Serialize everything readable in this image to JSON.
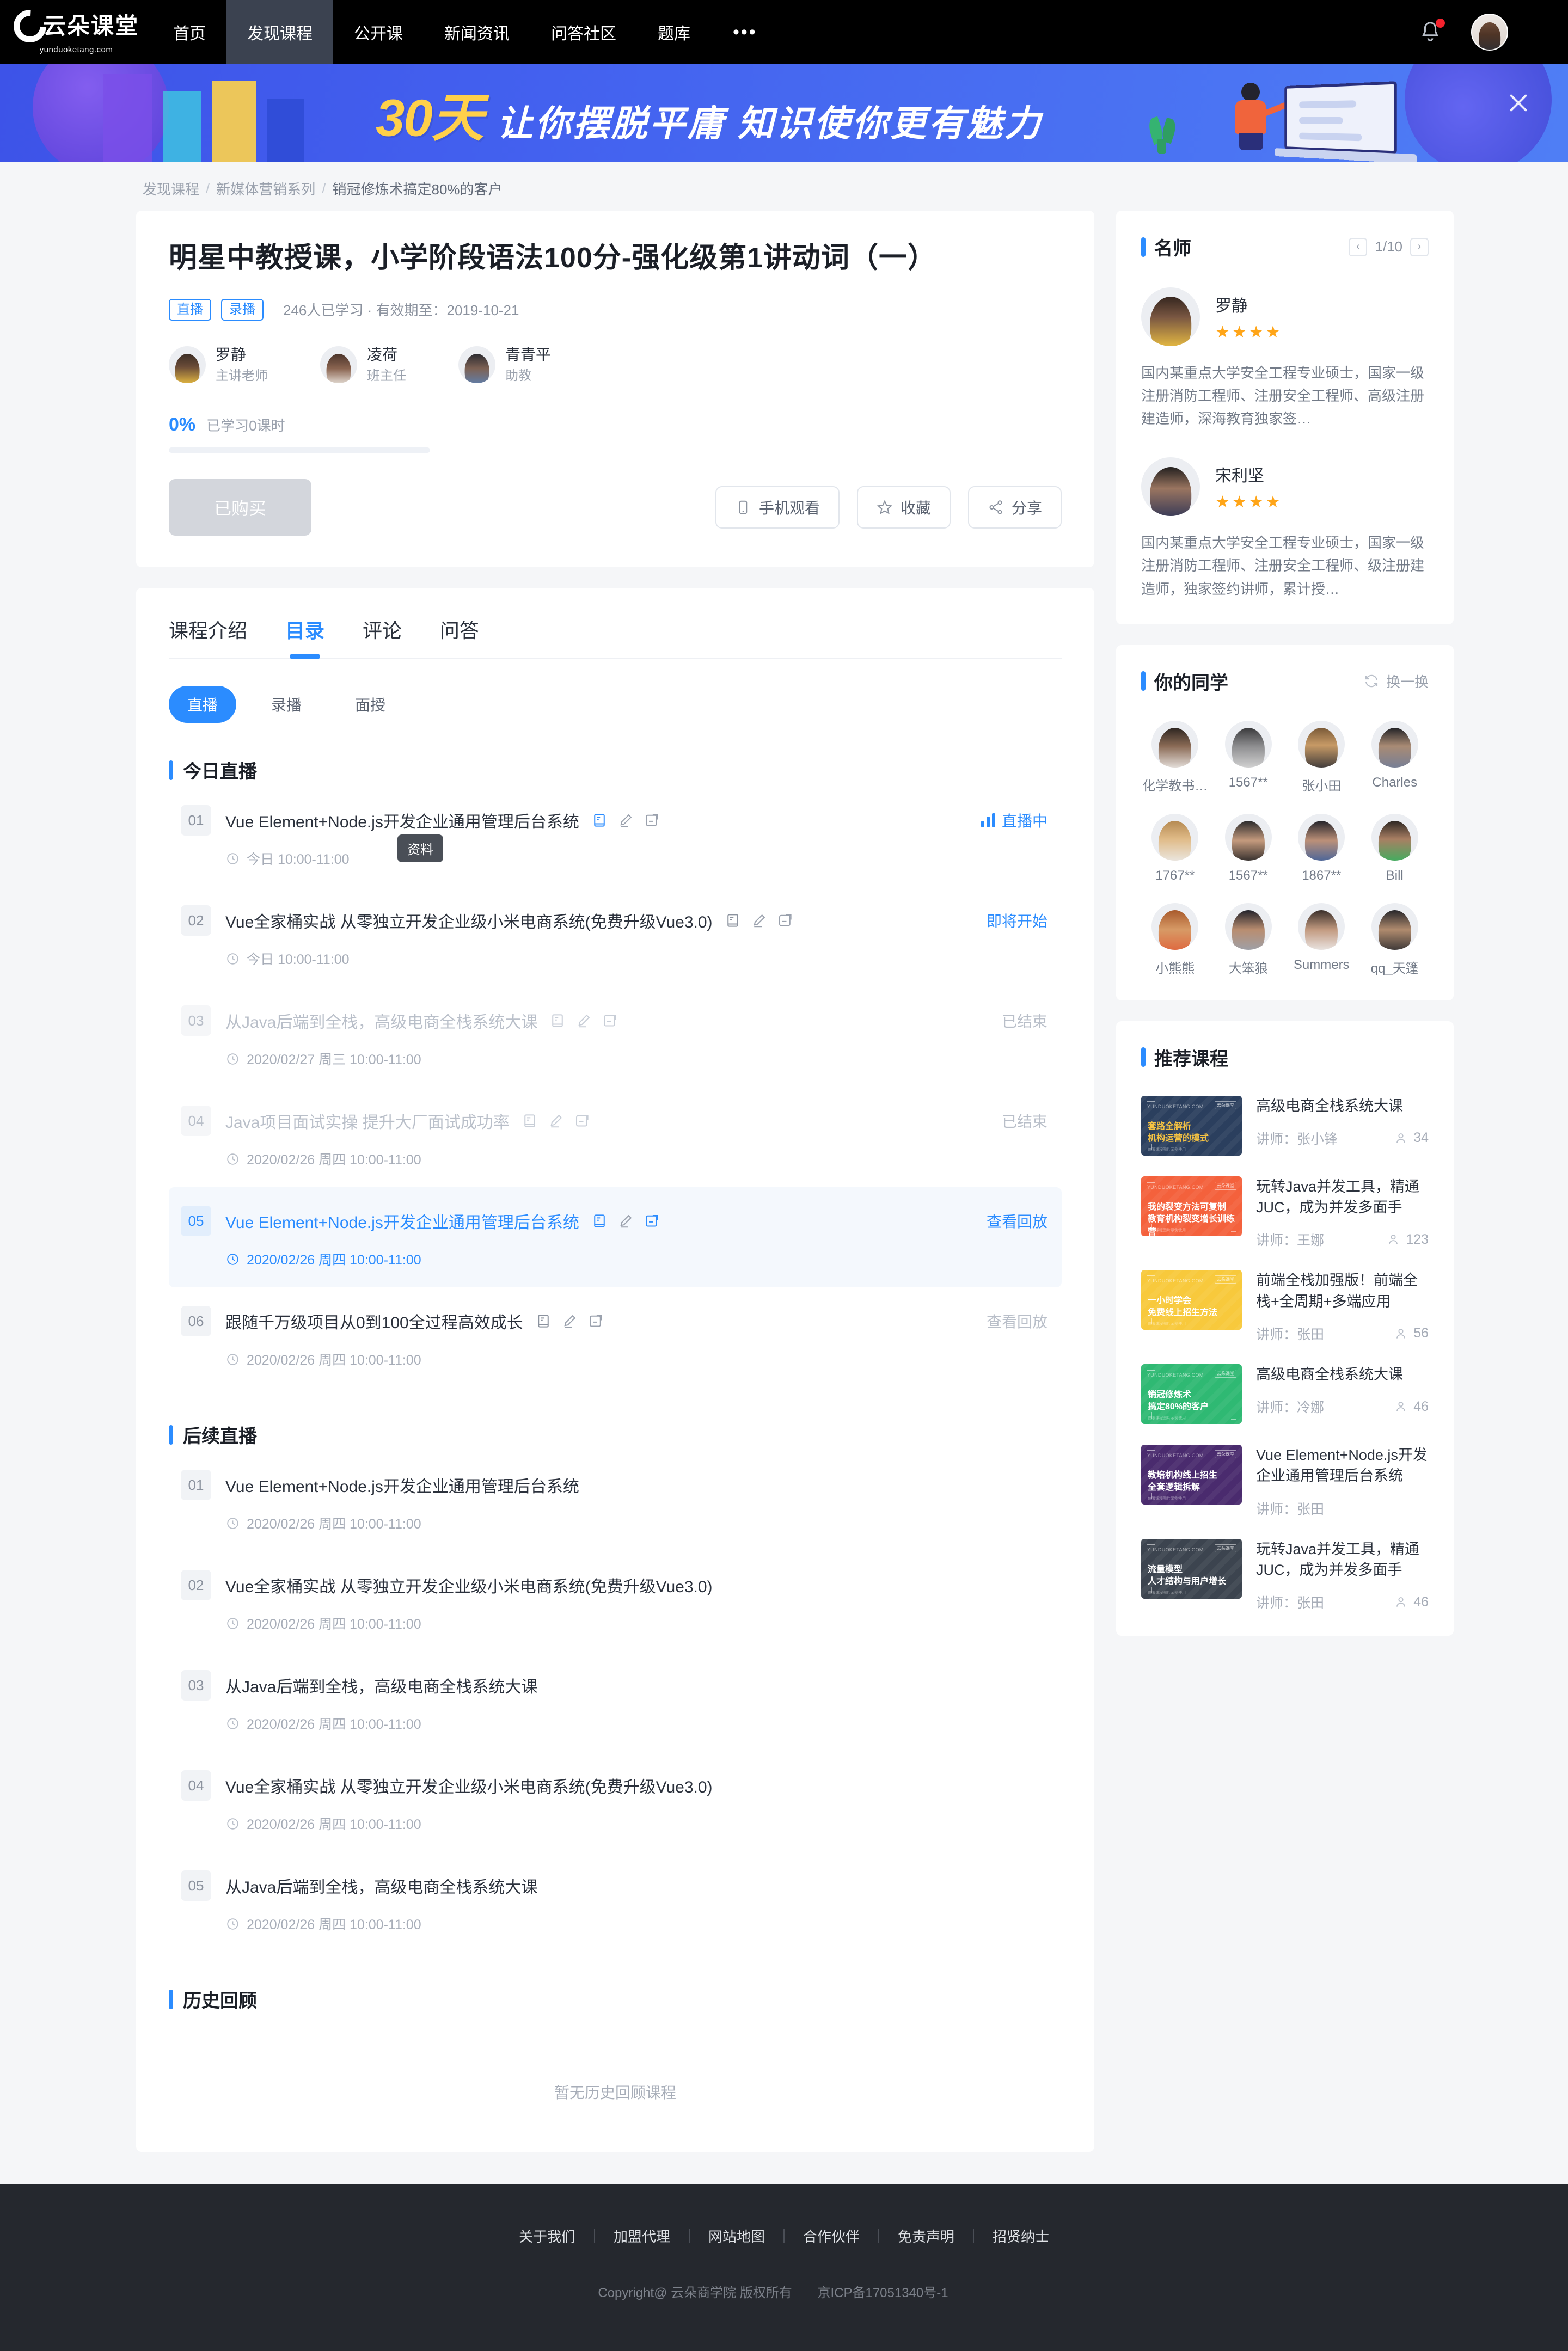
{
  "topnav": {
    "logo_cn": "云朵课堂",
    "logo_en": "yunduoketang.com",
    "items": [
      {
        "label": "首页",
        "active": false
      },
      {
        "label": "发现课程",
        "active": true
      },
      {
        "label": "公开课",
        "active": false
      },
      {
        "label": "新闻资讯",
        "active": false
      },
      {
        "label": "问答社区",
        "active": false
      },
      {
        "label": "题库",
        "active": false
      }
    ],
    "more": "•••"
  },
  "banner": {
    "highlight": "30天",
    "headline": "让你摆脱平庸  知识使你更有魅力"
  },
  "breadcrumb": {
    "item1": "发现课程",
    "item2": "新媒体营销系列",
    "item3": "销冠修炼术搞定80%的客户",
    "sep": "/"
  },
  "course": {
    "title": "明星中教授课，小学阶段语法100分-强化级第1讲动词（一）",
    "tags": [
      "直播",
      "录播"
    ],
    "meta": "246人已学习 · 有效期至：2019-10-21",
    "teachers": [
      {
        "name": "罗静",
        "role": "主讲老师"
      },
      {
        "name": "凌荷",
        "role": "班主任"
      },
      {
        "name": "青青平",
        "role": "助教"
      }
    ],
    "progress_pct": "0%",
    "progress_desc": "已学习0课时",
    "progress_value": 0,
    "buy_label": "已购买",
    "actions": [
      {
        "label": "手机观看",
        "icon": "phone-icon"
      },
      {
        "label": "收藏",
        "icon": "star-icon"
      },
      {
        "label": "分享",
        "icon": "share-icon"
      }
    ]
  },
  "catalog": {
    "tabs": [
      {
        "label": "课程介绍",
        "active": false
      },
      {
        "label": "目录",
        "active": true
      },
      {
        "label": "评论",
        "active": false
      },
      {
        "label": "问答",
        "active": false
      }
    ],
    "subtabs": [
      {
        "label": "直播",
        "active": true
      },
      {
        "label": "录播",
        "active": false
      },
      {
        "label": "面授",
        "active": false
      }
    ],
    "tooltip": "资料",
    "sections": [
      {
        "title": "今日直播",
        "lessons": [
          {
            "num": "01",
            "title": "Vue Element+Node.js开发企业通用管理后台系统",
            "time": "今日 10:00-11:00",
            "status": "直播中",
            "state": "live",
            "icons": true
          },
          {
            "num": "02",
            "title": "Vue全家桶实战 从零独立开发企业级小米电商系统(免费升级Vue3.0)",
            "time": "今日 10:00-11:00",
            "status": "即将开始",
            "state": "soon",
            "icons": true
          },
          {
            "num": "03",
            "title": "从Java后端到全栈，高级电商全栈系统大课",
            "time": "2020/02/27 周三 10:00-11:00",
            "status": "已结束",
            "state": "ended",
            "icons": true
          },
          {
            "num": "04",
            "title": "Java项目面试实操 提升大厂面试成功率",
            "time": "2020/02/26 周四 10:00-11:00",
            "status": "已结束",
            "state": "ended",
            "icons": true
          },
          {
            "num": "05",
            "title": "Vue Element+Node.js开发企业通用管理后台系统",
            "time": "2020/02/26 周四 10:00-11:00",
            "status": "查看回放",
            "state": "highlight",
            "icons": true
          },
          {
            "num": "06",
            "title": "跟随千万级项目从0到100全过程高效成长",
            "time": "2020/02/26 周四 10:00-11:00",
            "status": "查看回放",
            "state": "replay",
            "icons": true
          }
        ]
      },
      {
        "title": "后续直播",
        "lessons": [
          {
            "num": "01",
            "title": "Vue Element+Node.js开发企业通用管理后台系统",
            "time": "2020/02/26 周四 10:00-11:00",
            "status": "",
            "state": "plain",
            "icons": false
          },
          {
            "num": "02",
            "title": "Vue全家桶实战 从零独立开发企业级小米电商系统(免费升级Vue3.0)",
            "time": "2020/02/26 周四 10:00-11:00",
            "status": "",
            "state": "plain",
            "icons": false
          },
          {
            "num": "03",
            "title": "从Java后端到全栈，高级电商全栈系统大课",
            "time": "2020/02/26 周四 10:00-11:00",
            "status": "",
            "state": "plain",
            "icons": false
          },
          {
            "num": "04",
            "title": "Vue全家桶实战 从零独立开发企业级小米电商系统(免费升级Vue3.0)",
            "time": "2020/02/26 周四 10:00-11:00",
            "status": "",
            "state": "plain",
            "icons": false
          },
          {
            "num": "05",
            "title": "从Java后端到全栈，高级电商全栈系统大课",
            "time": "2020/02/26 周四 10:00-11:00",
            "status": "",
            "state": "plain",
            "icons": false
          }
        ]
      },
      {
        "title": "历史回顾",
        "empty": "暂无历史回顾课程",
        "lessons": []
      }
    ]
  },
  "sidebar": {
    "masters": {
      "title": "名师",
      "page": "1/10",
      "prev": "‹",
      "next": "›",
      "list": [
        {
          "name": "罗静",
          "stars": "★★★★",
          "desc": "国内某重点大学安全工程专业硕士，国家一级注册消防工程师、注册安全工程师、高级注册建造师，深海教育独家签…"
        },
        {
          "name": "宋利坚",
          "stars": "★★★★",
          "desc": "国内某重点大学安全工程专业硕士，国家一级注册消防工程师、注册安全工程师、级注册建造师，独家签约讲师，累计授…"
        }
      ]
    },
    "classmates": {
      "title": "你的同学",
      "refresh_label": "换一换",
      "list": [
        {
          "name": "化学教书…"
        },
        {
          "name": "1567**"
        },
        {
          "name": "张小田"
        },
        {
          "name": "Charles"
        },
        {
          "name": "1767**"
        },
        {
          "name": "1567**"
        },
        {
          "name": "1867**"
        },
        {
          "name": "Bill"
        },
        {
          "name": "小熊熊"
        },
        {
          "name": "大笨狼"
        },
        {
          "name": "Summers"
        },
        {
          "name": "qq_天篷"
        }
      ]
    },
    "recommend": {
      "title": "推荐课程",
      "teacher_prefix": "讲师：",
      "list": [
        {
          "title": "高级电商全栈系统大课",
          "teacher": "讲师：张小锋",
          "count": "34",
          "thumb_color": "#2b3f5e",
          "thumb_t1": "套路全解析",
          "thumb_t2": "机构运营的模式",
          "thumb_text_color": "#f5c242",
          "thumb_foot": "仅限课程图片示例使用"
        },
        {
          "title": "玩转Java并发工具，精通JUC，成为并发多面手",
          "teacher": "讲师：王娜",
          "count": "123",
          "thumb_color": "#f4613c",
          "thumb_t1": "我的裂变方法可复制",
          "thumb_t2": "教育机构裂变增长训练营",
          "thumb_text_color": "#ffffff",
          "thumb_foot": "仅限课程图片示例使用"
        },
        {
          "title": "前端全栈加强版！前端全栈+全周期+多端应用",
          "teacher": "讲师：张田",
          "count": "56",
          "thumb_color": "#f8c93c",
          "thumb_t1": "一小时学会",
          "thumb_t2": "免费线上招生方法",
          "thumb_text_color": "#ffffff",
          "thumb_foot": "仅限课程图片示例使用"
        },
        {
          "title": "高级电商全栈系统大课",
          "teacher": "讲师：冷娜",
          "count": "46",
          "thumb_color": "#2fb973",
          "thumb_t1": "销冠修炼术",
          "thumb_t2": "搞定80%的客户",
          "thumb_text_color": "#ffffff",
          "thumb_foot": "仅限课程图片示例使用"
        },
        {
          "title": "Vue Element+Node.js开发企业通用管理后台系统",
          "teacher": "讲师：张田",
          "count": "",
          "thumb_color": "#4a2b6e",
          "thumb_t1": "教培机构线上招生",
          "thumb_t2": "全套逻辑拆解",
          "thumb_text_color": "#ffffff",
          "thumb_foot": "仅限课程图片示例使用"
        },
        {
          "title": "玩转Java并发工具，精通JUC，成为并发多面手",
          "teacher": "讲师：张田",
          "count": "46",
          "thumb_color": "#3c444f",
          "thumb_t1": "流量模型",
          "thumb_t2": "人才结构与用户增长",
          "thumb_text_color": "#ffffff",
          "thumb_foot": "仅限课程图片示例使用"
        }
      ]
    }
  },
  "footer": {
    "links": [
      "关于我们",
      "加盟代理",
      "网站地图",
      "合作伙伴",
      "免责声明",
      "招贤纳士"
    ],
    "copyright": "Copyright@ 云朵商学院  版权所有",
    "icp": "京ICP备17051340号-1"
  },
  "colors": {
    "accent": "#2b8cff",
    "nav_bg": "#000000",
    "nav_active": "#3b4250",
    "banner_from": "#3d53e8",
    "banner_to": "#4f7ef5",
    "star": "#ffa518",
    "footer_bg": "#25282e",
    "page_bg": "#f5f6f8"
  }
}
